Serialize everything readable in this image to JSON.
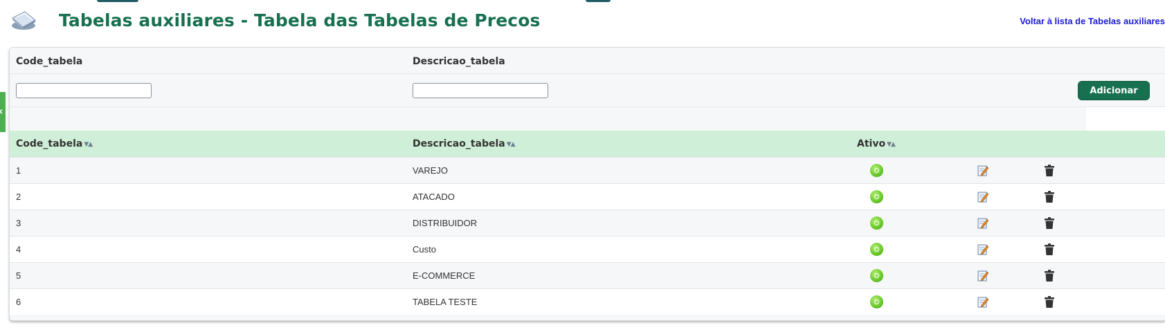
{
  "header": {
    "title": "Tabelas auxiliares - Tabela das Tabelas de Precos",
    "back_link": "Voltar à lista de Tabelas auxiliares",
    "logo_icon": "tablet-stack-icon"
  },
  "filter": {
    "code_label": "Code_tabela",
    "descricao_label": "Descricao_tabela",
    "code_value": "",
    "descricao_value": "",
    "add_button": "Adicionar"
  },
  "grid": {
    "columns": [
      "Code_tabela",
      "Descricao_tabela",
      "Ativo"
    ],
    "rows": [
      {
        "code": "1",
        "descricao": "VAREJO",
        "ativo": "active"
      },
      {
        "code": "2",
        "descricao": "ATACADO",
        "ativo": "active"
      },
      {
        "code": "3",
        "descricao": "DISTRIBUIDOR",
        "ativo": "active"
      },
      {
        "code": "4",
        "descricao": "Custo",
        "ativo": "active"
      },
      {
        "code": "5",
        "descricao": "E-COMMERCE",
        "ativo": "active"
      },
      {
        "code": "6",
        "descricao": "TABELA TESTE",
        "ativo": "active"
      }
    ],
    "row_icons": {
      "status": "active-status-icon",
      "edit": "edit-icon",
      "delete": "trash-icon"
    }
  },
  "colors": {
    "title_green": "#17704f",
    "header_row": "#cfefd8",
    "link_blue": "#1a1ad6",
    "button_green": "#17704f",
    "side_tab": "#4caf50"
  }
}
